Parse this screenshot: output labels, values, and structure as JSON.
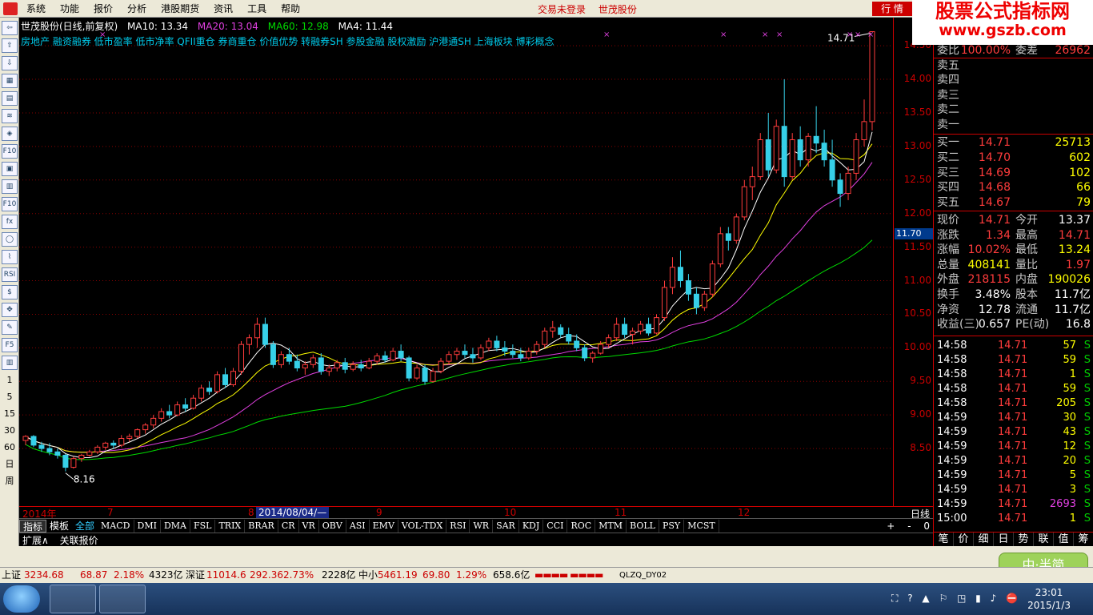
{
  "menu": {
    "items": [
      "系统",
      "功能",
      "报价",
      "分析",
      "港股期货",
      "资讯",
      "工具",
      "帮助"
    ],
    "status_login": "交易未登录",
    "status_stock": "世茂股份",
    "mode_button": "行 情",
    "brand_title": "股票公式指标网",
    "brand_url": "www.gszb.com"
  },
  "chart_header": {
    "title": "世茂股份(日线,前复权)",
    "ma10": "MA10: 13.34",
    "ma20": "MA20: 13.04",
    "ma60": "MA60: 12.98",
    "ma4": "MA4: 11.44",
    "concepts": "房地产 融资融券 低市盈率 低市净率 QFII重仓 券商重仓 价值优势 转融券SH 参股金融 股权激励 沪港通SH 上海板块 博彩概念",
    "last_price_label": "14.71",
    "low_price_label": "8.16"
  },
  "colors": {
    "bg": "#000000",
    "up": "#ff3c3c",
    "down": "#36d0e8",
    "ma10": "#ffffff",
    "ma20": "#ffff00",
    "ma60": "#e040e0",
    "ma4": "#00dc00",
    "axis": "#cc0000"
  },
  "y_axis": {
    "ticks": [
      "14.50",
      "14.00",
      "13.50",
      "13.00",
      "12.50",
      "12.00",
      "11.50",
      "11.00",
      "10.50",
      "10.00",
      "9.50",
      "9.00",
      "8.50"
    ],
    "current_tag": "11.70"
  },
  "x_axis": {
    "labels": [
      "2014年",
      "7",
      "8",
      "9",
      "10",
      "11",
      "12"
    ],
    "selected": "2014/08/04/—",
    "period": "日线"
  },
  "left_toolbar": {
    "icons": [
      "return-icon",
      "up-arrow-icon",
      "down-arrow-icon",
      "realtime-icon",
      "list-icon",
      "kline-icon",
      "multi-icon",
      "f10-icon",
      "doc-icon",
      "info-icon",
      "f10b-icon",
      "fx-icon",
      "circle-icon",
      "trend-icon",
      "rsi-icon",
      "money-icon",
      "move-icon",
      "pencil-icon",
      "f5-icon",
      "config-icon"
    ],
    "tool_labels": [
      "⇦",
      "⇧",
      "⇩",
      "▦",
      "▤",
      "≋",
      "◈",
      "F10",
      "▣",
      "▥",
      "F10",
      "fx",
      "◯",
      "⌇",
      "RSI",
      "$",
      "✥",
      "✎",
      "F5",
      "▥"
    ],
    "period_nums": [
      "1",
      "5",
      "15",
      "30",
      "60",
      "日",
      "周"
    ]
  },
  "indicator_tabs": {
    "categories": [
      "指标",
      "模板",
      "全部"
    ],
    "indicators": [
      "MACD",
      "DMI",
      "DMA",
      "FSL",
      "TRIX",
      "BRAR",
      "CR",
      "VR",
      "OBV",
      "ASI",
      "EMV",
      "VOL-TDX",
      "RSI",
      "WR",
      "SAR",
      "KDJ",
      "CCI",
      "ROC",
      "MTM",
      "BOLL",
      "PSY",
      "MCST"
    ],
    "controls": [
      "+",
      "-",
      "0"
    ]
  },
  "extra_bar": [
    "扩展∧",
    "关联报价"
  ],
  "quote_panel": {
    "top_row": {
      "label": "委比",
      "value": "100.00%",
      "label2": "委差",
      "value2": "26962"
    },
    "sells": [
      {
        "label": "卖五"
      },
      {
        "label": "卖四"
      },
      {
        "label": "卖三"
      },
      {
        "label": "卖二"
      },
      {
        "label": "卖一"
      }
    ],
    "buys": [
      {
        "label": "买一",
        "price": "14.71",
        "vol": "25713"
      },
      {
        "label": "买二",
        "price": "14.70",
        "vol": "602"
      },
      {
        "label": "买三",
        "price": "14.69",
        "vol": "102"
      },
      {
        "label": "买四",
        "price": "14.68",
        "vol": "66"
      },
      {
        "label": "买五",
        "price": "14.67",
        "vol": "79"
      }
    ],
    "stats": [
      {
        "l1": "现价",
        "v1": "14.71",
        "c1": "#ff3c3c",
        "l2": "今开",
        "v2": "13.37",
        "c2": "#ffffff"
      },
      {
        "l1": "涨跌",
        "v1": "1.34",
        "c1": "#ff3c3c",
        "l2": "最高",
        "v2": "14.71",
        "c2": "#ff3c3c"
      },
      {
        "l1": "涨幅",
        "v1": "10.02%",
        "c1": "#ff3c3c",
        "l2": "最低",
        "v2": "13.24",
        "c2": "#ffff00"
      },
      {
        "l1": "总量",
        "v1": "408141",
        "c1": "#ffff00",
        "l2": "量比",
        "v2": "1.97",
        "c2": "#ff3c3c"
      },
      {
        "l1": "外盘",
        "v1": "218115",
        "c1": "#ff3c3c",
        "l2": "内盘",
        "v2": "190026",
        "c2": "#ffff00"
      },
      {
        "l1": "换手",
        "v1": "3.48%",
        "c1": "#ffffff",
        "l2": "股本",
        "v2": "11.7亿",
        "c2": "#ffffff"
      },
      {
        "l1": "净资",
        "v1": "12.78",
        "c1": "#ffffff",
        "l2": "流通",
        "v2": "11.7亿",
        "c2": "#ffffff"
      },
      {
        "l1": "收益(三)",
        "v1": "0.657",
        "c1": "#ffffff",
        "l2": "PE(动)",
        "v2": "16.8",
        "c2": "#ffffff"
      }
    ],
    "ticks": [
      {
        "time": "14:58",
        "price": "14.71",
        "vol": "57",
        "side": "S",
        "vc": "#ffff00"
      },
      {
        "time": "14:58",
        "price": "14.71",
        "vol": "59",
        "side": "S",
        "vc": "#ffff00"
      },
      {
        "time": "14:58",
        "price": "14.71",
        "vol": "1",
        "side": "S",
        "vc": "#ffff00"
      },
      {
        "time": "14:58",
        "price": "14.71",
        "vol": "59",
        "side": "S",
        "vc": "#ffff00"
      },
      {
        "time": "14:58",
        "price": "14.71",
        "vol": "205",
        "side": "S",
        "vc": "#ffff00"
      },
      {
        "time": "14:59",
        "price": "14.71",
        "vol": "30",
        "side": "S",
        "vc": "#ffff00"
      },
      {
        "time": "14:59",
        "price": "14.71",
        "vol": "43",
        "side": "S",
        "vc": "#ffff00"
      },
      {
        "time": "14:59",
        "price": "14.71",
        "vol": "12",
        "side": "S",
        "vc": "#ffff00"
      },
      {
        "time": "14:59",
        "price": "14.71",
        "vol": "20",
        "side": "S",
        "vc": "#ffff00"
      },
      {
        "time": "14:59",
        "price": "14.71",
        "vol": "5",
        "side": "S",
        "vc": "#ffff00"
      },
      {
        "time": "14:59",
        "price": "14.71",
        "vol": "3",
        "side": "S",
        "vc": "#ffff00"
      },
      {
        "time": "14:59",
        "price": "14.71",
        "vol": "2693",
        "side": "S",
        "vc": "#e040e0"
      },
      {
        "time": "15:00",
        "price": "14.71",
        "vol": "1",
        "side": "S",
        "vc": "#ffff00"
      }
    ],
    "bottom_tabs": [
      "笔",
      "价",
      "细",
      "日",
      "势",
      "联",
      "值",
      "筹"
    ]
  },
  "status_bar": {
    "sh_label": "上证",
    "sh_value": "3234.68",
    "sh_change": "68.87",
    "sh_pct": "2.18%",
    "sh_amount": "4323亿",
    "sz_label": "深证",
    "sz_value": "11014.6",
    "sz_change": "292.36",
    "sz_pct": "2.73%",
    "sz_amount": "2228亿",
    "zx_label": "中小",
    "zx_value": "5461.19",
    "zx_change": "69.80",
    "zx_pct": "1.29%",
    "zx_amount": "658.6亿",
    "server": "QLZQ_DY02",
    "badge": "中·半简"
  },
  "taskbar": {
    "time": "23:01",
    "date": "2015/1/3"
  },
  "chart_data": {
    "type": "candlestick",
    "x_labels": [
      "2014年",
      "7",
      "8",
      "9",
      "10",
      "11",
      "12"
    ],
    "ylim": [
      8.0,
      14.8
    ],
    "y_ticks": [
      8.5,
      9.0,
      9.5,
      10.0,
      10.5,
      11.0,
      11.5,
      12.0,
      12.5,
      13.0,
      13.5,
      14.0,
      14.5
    ],
    "series_ma": [
      {
        "name": "MA10",
        "value": 13.34
      },
      {
        "name": "MA20",
        "value": 13.04
      },
      {
        "name": "MA60",
        "value": 12.98
      },
      {
        "name": "MA4",
        "value": 11.44
      }
    ],
    "ohlc": [
      [
        8.62,
        8.7,
        8.55,
        8.68
      ],
      [
        8.68,
        8.7,
        8.52,
        8.55
      ],
      [
        8.55,
        8.6,
        8.45,
        8.5
      ],
      [
        8.5,
        8.58,
        8.4,
        8.45
      ],
      [
        8.45,
        8.5,
        8.35,
        8.4
      ],
      [
        8.4,
        8.42,
        8.16,
        8.22
      ],
      [
        8.22,
        8.38,
        8.2,
        8.35
      ],
      [
        8.35,
        8.42,
        8.3,
        8.4
      ],
      [
        8.4,
        8.48,
        8.38,
        8.45
      ],
      [
        8.45,
        8.55,
        8.42,
        8.52
      ],
      [
        8.52,
        8.6,
        8.48,
        8.58
      ],
      [
        8.58,
        8.62,
        8.5,
        8.55
      ],
      [
        8.55,
        8.7,
        8.52,
        8.65
      ],
      [
        8.65,
        8.72,
        8.6,
        8.68
      ],
      [
        8.68,
        8.8,
        8.65,
        8.78
      ],
      [
        8.78,
        8.88,
        8.72,
        8.85
      ],
      [
        8.85,
        9.0,
        8.8,
        8.95
      ],
      [
        8.95,
        9.1,
        8.9,
        9.05
      ],
      [
        9.05,
        9.15,
        8.95,
        9.0
      ],
      [
        9.0,
        9.2,
        8.98,
        9.15
      ],
      [
        9.15,
        9.25,
        9.05,
        9.1
      ],
      [
        9.1,
        9.3,
        9.08,
        9.25
      ],
      [
        9.25,
        9.45,
        9.2,
        9.4
      ],
      [
        9.4,
        9.5,
        9.3,
        9.35
      ],
      [
        9.35,
        9.65,
        9.32,
        9.6
      ],
      [
        9.6,
        9.7,
        9.4,
        9.45
      ],
      [
        9.45,
        9.7,
        9.42,
        9.65
      ],
      [
        9.65,
        10.1,
        9.6,
        10.05
      ],
      [
        10.05,
        10.2,
        9.9,
        10.15
      ],
      [
        10.15,
        10.45,
        10.0,
        10.35
      ],
      [
        10.35,
        10.45,
        10.0,
        10.05
      ],
      [
        10.05,
        10.1,
        9.7,
        9.75
      ],
      [
        9.75,
        9.95,
        9.7,
        9.9
      ],
      [
        9.9,
        10.0,
        9.75,
        9.8
      ],
      [
        9.8,
        9.9,
        9.65,
        9.7
      ],
      [
        9.7,
        9.8,
        9.6,
        9.75
      ],
      [
        9.75,
        9.9,
        9.7,
        9.85
      ],
      [
        9.85,
        9.92,
        9.6,
        9.65
      ],
      [
        9.65,
        9.75,
        9.58,
        9.7
      ],
      [
        9.7,
        9.82,
        9.65,
        9.78
      ],
      [
        9.78,
        9.85,
        9.62,
        9.68
      ],
      [
        9.68,
        9.8,
        9.65,
        9.75
      ],
      [
        9.75,
        9.82,
        9.65,
        9.7
      ],
      [
        9.7,
        9.85,
        9.68,
        9.8
      ],
      [
        9.8,
        9.92,
        9.75,
        9.88
      ],
      [
        9.88,
        9.95,
        9.78,
        9.82
      ],
      [
        9.82,
        10.0,
        9.8,
        9.95
      ],
      [
        9.95,
        10.05,
        9.8,
        9.85
      ],
      [
        9.85,
        9.88,
        9.5,
        9.55
      ],
      [
        9.55,
        9.75,
        9.52,
        9.7
      ],
      [
        9.7,
        9.75,
        9.45,
        9.5
      ],
      [
        9.5,
        9.7,
        9.48,
        9.65
      ],
      [
        9.65,
        9.85,
        9.62,
        9.8
      ],
      [
        9.8,
        9.95,
        9.75,
        9.9
      ],
      [
        9.9,
        10.0,
        9.82,
        9.95
      ],
      [
        9.95,
        10.05,
        9.85,
        9.9
      ],
      [
        9.9,
        10.0,
        9.78,
        9.85
      ],
      [
        9.85,
        10.05,
        9.82,
        10.0
      ],
      [
        10.0,
        10.15,
        9.95,
        10.1
      ],
      [
        10.1,
        10.18,
        9.95,
        10.0
      ],
      [
        10.0,
        10.1,
        9.88,
        9.95
      ],
      [
        9.95,
        10.05,
        9.85,
        9.9
      ],
      [
        9.9,
        10.0,
        9.8,
        9.85
      ],
      [
        9.85,
        10.0,
        9.82,
        9.95
      ],
      [
        9.95,
        10.1,
        9.9,
        10.05
      ],
      [
        10.05,
        10.3,
        10.0,
        10.25
      ],
      [
        10.25,
        10.4,
        10.15,
        10.3
      ],
      [
        10.3,
        10.35,
        10.15,
        10.2
      ],
      [
        10.2,
        10.3,
        10.05,
        10.1
      ],
      [
        10.1,
        10.2,
        9.95,
        10.0
      ],
      [
        10.0,
        10.05,
        9.8,
        9.85
      ],
      [
        9.85,
        9.95,
        9.78,
        9.92
      ],
      [
        9.92,
        10.1,
        9.9,
        10.05
      ],
      [
        10.05,
        10.2,
        10.0,
        10.15
      ],
      [
        10.15,
        10.45,
        10.1,
        10.35
      ],
      [
        10.35,
        10.45,
        10.15,
        10.2
      ],
      [
        10.2,
        10.3,
        10.05,
        10.25
      ],
      [
        10.25,
        10.4,
        10.2,
        10.35
      ],
      [
        10.35,
        10.45,
        10.18,
        10.22
      ],
      [
        10.22,
        10.5,
        10.2,
        10.45
      ],
      [
        10.45,
        11.0,
        10.4,
        10.9
      ],
      [
        10.9,
        11.35,
        10.8,
        11.2
      ],
      [
        11.2,
        11.45,
        10.9,
        11.0
      ],
      [
        11.0,
        11.1,
        10.7,
        10.8
      ],
      [
        10.8,
        10.9,
        10.5,
        10.6
      ],
      [
        10.6,
        10.85,
        10.55,
        10.8
      ],
      [
        10.8,
        11.3,
        10.75,
        11.25
      ],
      [
        11.25,
        11.8,
        11.2,
        11.7
      ],
      [
        11.7,
        11.8,
        11.45,
        11.6
      ],
      [
        11.6,
        12.0,
        11.55,
        11.95
      ],
      [
        11.95,
        12.5,
        11.9,
        12.4
      ],
      [
        12.4,
        12.7,
        12.2,
        12.55
      ],
      [
        12.55,
        13.2,
        12.5,
        13.1
      ],
      [
        13.1,
        13.5,
        12.55,
        12.65
      ],
      [
        12.65,
        13.4,
        12.6,
        13.3
      ],
      [
        13.3,
        14.0,
        12.4,
        12.55
      ],
      [
        12.55,
        13.2,
        12.5,
        13.1
      ],
      [
        13.1,
        13.3,
        12.7,
        12.8
      ],
      [
        12.8,
        13.2,
        12.7,
        13.15
      ],
      [
        13.15,
        13.6,
        12.9,
        13.05
      ],
      [
        13.05,
        13.25,
        12.7,
        12.8
      ],
      [
        12.8,
        13.1,
        12.4,
        12.5
      ],
      [
        12.5,
        12.6,
        12.1,
        12.3
      ],
      [
        12.3,
        12.7,
        12.2,
        12.6
      ],
      [
        12.6,
        13.2,
        12.5,
        13.1
      ],
      [
        13.1,
        13.7,
        13.0,
        13.37
      ],
      [
        13.37,
        14.71,
        13.24,
        14.71
      ]
    ]
  }
}
